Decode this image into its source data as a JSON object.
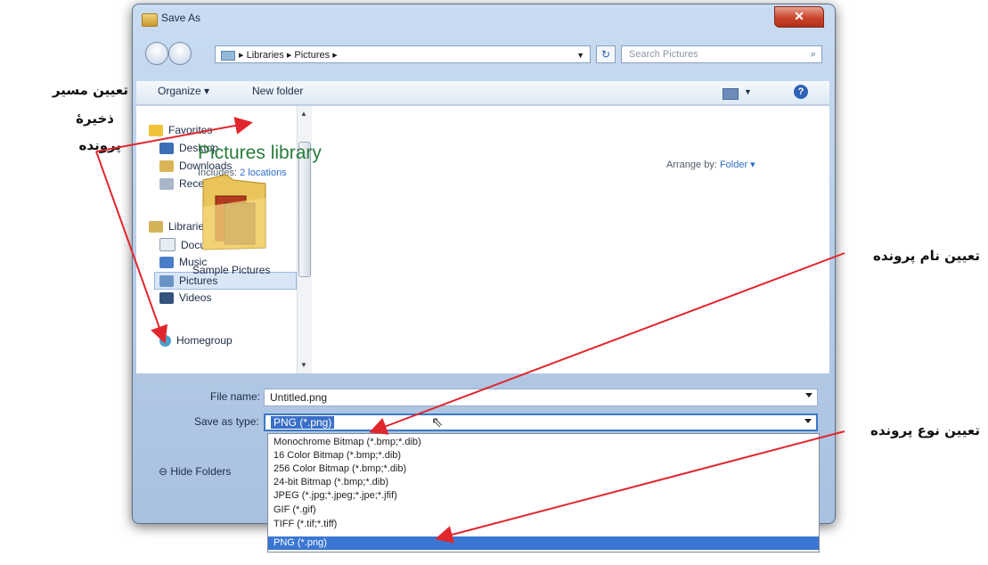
{
  "window": {
    "title": "Save As",
    "close_glyph": "✕"
  },
  "address_bar": {
    "path": "▸ Libraries ▸ Pictures ▸",
    "search_placeholder": "Search Pictures"
  },
  "toolbar": {
    "organize": "Organize ▾",
    "new_folder": "New folder"
  },
  "sidebar": {
    "favorites": "Favorites",
    "desktop": "Desktop",
    "downloads": "Downloads",
    "recent": "Recent Places",
    "libraries": "Libraries",
    "documents": "Documents",
    "music": "Music",
    "pictures": "Pictures",
    "videos": "Videos",
    "homegroup": "Homegroup"
  },
  "library": {
    "title": "Pictures library",
    "includes_label": "Includes:",
    "includes_link": "2 locations",
    "arrange_label": "Arrange by:",
    "arrange_value": "Folder ▾",
    "folder_name": "Sample Pictures"
  },
  "form": {
    "filename_label": "File name:",
    "filename_value": "Untitled.png",
    "savetype_label": "Save as type:",
    "savetype_value": "PNG (*.png)"
  },
  "dropdown_options": [
    "Monochrome Bitmap (*.bmp;*.dib)",
    "16 Color Bitmap (*.bmp;*.dib)",
    "256 Color Bitmap (*.bmp;*.dib)",
    "24-bit Bitmap (*.bmp;*.dib)",
    "JPEG (*.jpg;*.jpeg;*.jpe;*.jfif)",
    "GIF (*.gif)",
    "TIFF (*.tif;*.tiff)",
    "PNG (*.png)"
  ],
  "hide_folders": "Hide Folders",
  "annotations": {
    "path_line1": "تعیین مسیر",
    "path_line2": "ذخیرۀ",
    "path_line3": "پرونده",
    "filename": "تعیین نام پرونده",
    "filetype": "تعیین نوع پرونده"
  },
  "colors": {
    "arrow": "#e0262c",
    "library_title": "#2a7d3d",
    "selection": "#3a76d2"
  }
}
